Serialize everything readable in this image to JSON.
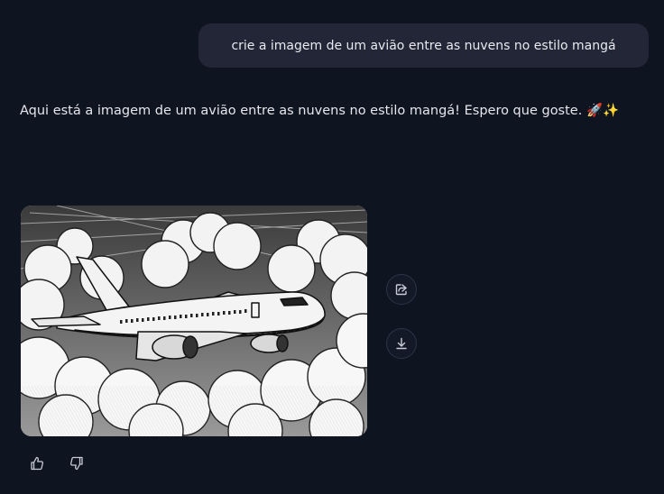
{
  "user_message": {
    "text": "crie a imagem de um avião entre as nuvens no estilo mangá"
  },
  "assistant_message": {
    "text": "Aqui está a imagem de um avião entre as nuvens no estilo mangá! Espero que goste. 🚀✨"
  },
  "image_actions": {
    "share_icon": "share-icon",
    "download_icon": "download-icon"
  },
  "feedback": {
    "like_icon": "thumbs-up-icon",
    "dislike_icon": "thumbs-down-icon"
  }
}
